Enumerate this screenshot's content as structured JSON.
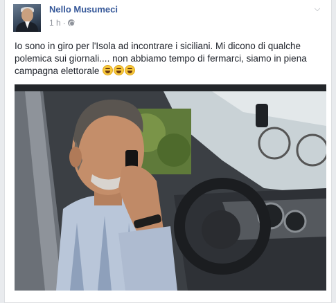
{
  "post": {
    "author": "Nello Musumeci",
    "time": "1 h",
    "separator": "·",
    "privacy_icon": "globe-icon",
    "options_icon": "chevron-down-icon",
    "text": "Io sono in giro per l'Isola ad incontrare i siciliani. Mi dicono di qualche polemica sui giornali.... non abbiamo tempo di fermarci, siamo in piena campagna elettorale",
    "emojis": [
      "laughing-emoji",
      "laughing-emoji",
      "laughing-emoji"
    ]
  }
}
